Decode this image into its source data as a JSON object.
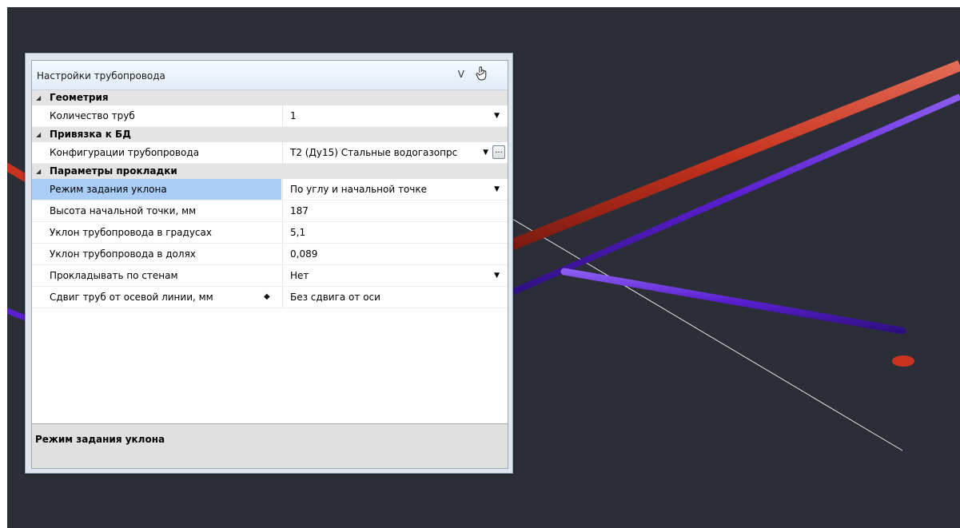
{
  "palette": {
    "title": "Настройки трубопровода",
    "collapse_label": "V",
    "categories": [
      {
        "label": "Геометрия",
        "rows": [
          {
            "name": "Количество труб",
            "value": "1",
            "has_dropdown": true
          }
        ]
      },
      {
        "label": "Привязка к БД",
        "rows": [
          {
            "name": "Конфигурации трубопровода",
            "value": "Т2 (Ду15) Стальные водогазопрс",
            "has_dropdown": true,
            "ellipsis": "..."
          }
        ]
      },
      {
        "label": "Параметры прокладки",
        "rows": [
          {
            "name": "Режим задания уклона",
            "value": "По углу и начальной точке",
            "has_dropdown": true,
            "selected": true
          },
          {
            "name": "Высота начальной точки, мм",
            "value": "187"
          },
          {
            "name": "Уклон трубопровода в градусах",
            "value": "5,1"
          },
          {
            "name": "Уклон трубопровода в долях",
            "value": "0,089"
          },
          {
            "name": "Прокладывать по стенам",
            "value": "Нет",
            "has_dropdown": true
          },
          {
            "name": "Сдвиг труб от осевой линии, мм",
            "value": "Без сдвига от оси",
            "has_diamond": true
          }
        ]
      }
    ],
    "description_title": "Режим задания уклона"
  },
  "colors": {
    "viewport_bg": "#2b2e36",
    "pipe_red": "#c8331f",
    "pipe_purple": "#5a1fd0",
    "selection": "#a9cdf5"
  }
}
